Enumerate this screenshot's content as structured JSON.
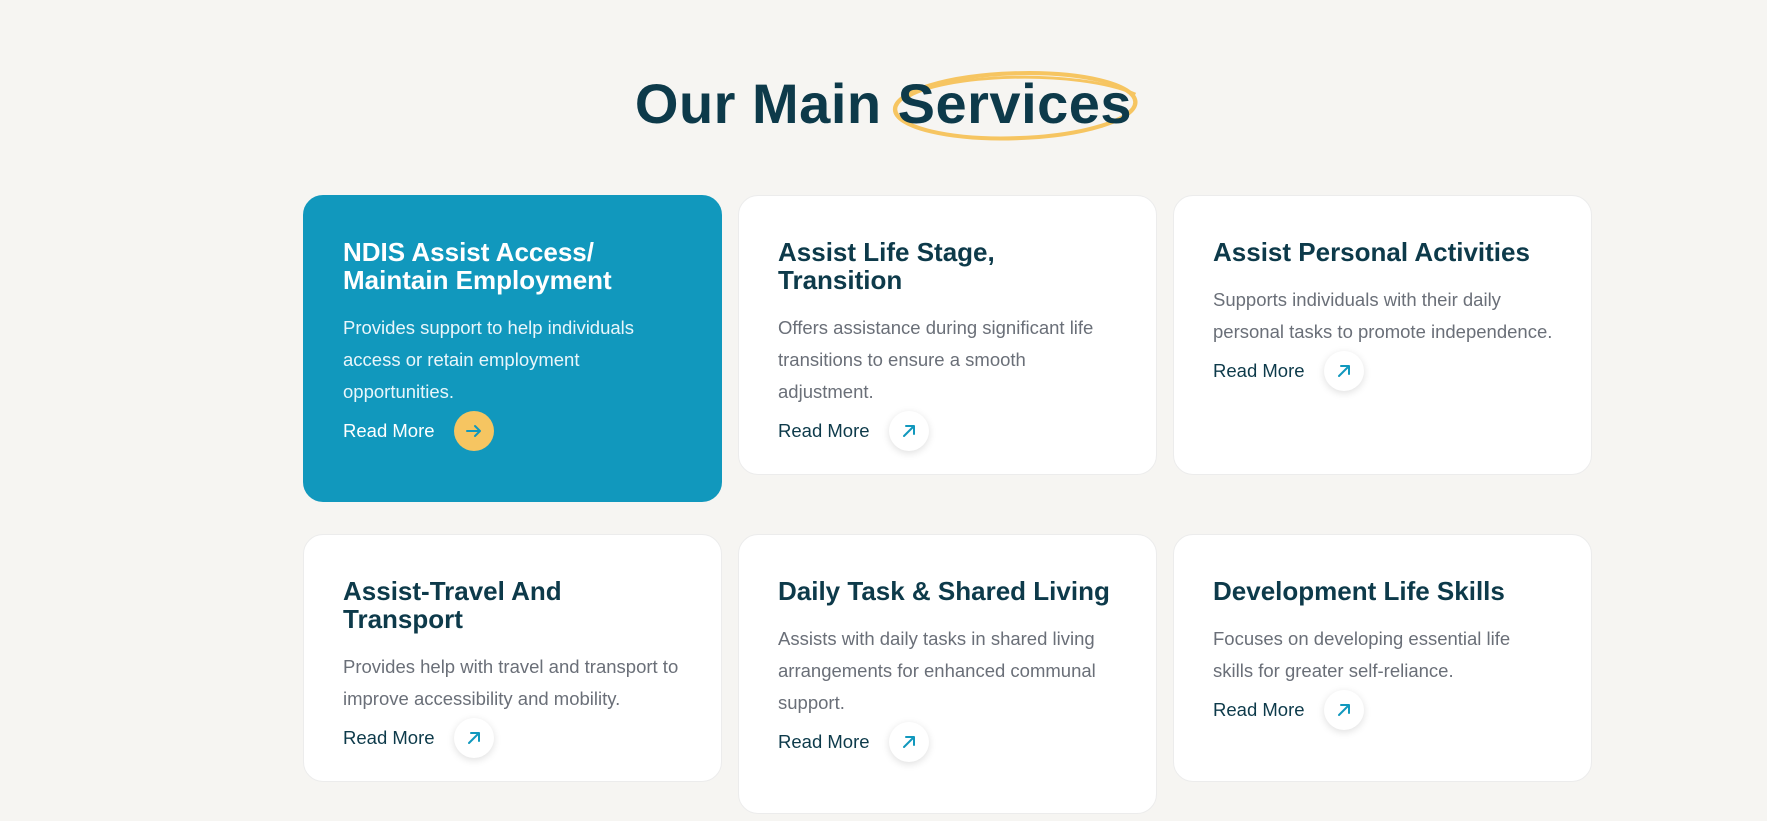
{
  "heading": {
    "prefix": "Our Main ",
    "highlight": "Services"
  },
  "services": [
    {
      "title": "NDIS Assist Access/ Maintain Employment",
      "description": "Provides support to help individuals access or retain employment opportunities.",
      "read_more": "Read More",
      "icon": "arrow-right-icon",
      "active": true
    },
    {
      "title": "Assist Life Stage, Transition",
      "description": "Offers assistance during significant life transitions to ensure a smooth adjustment.",
      "read_more": "Read More",
      "icon": "arrow-up-right-icon",
      "active": false
    },
    {
      "title": "Assist Personal Activities",
      "description": "Supports individuals with their daily personal tasks to promote independence.",
      "read_more": "Read More",
      "icon": "arrow-up-right-icon",
      "active": false
    },
    {
      "title": "Assist-Travel And Transport",
      "description": "Provides help with travel and transport to improve accessibility and mobility.",
      "read_more": "Read More",
      "icon": "arrow-up-right-icon",
      "active": false
    },
    {
      "title": "Daily Task & Shared Living",
      "description": "Assists with daily tasks in shared living arrangements for enhanced communal support.",
      "read_more": "Read More",
      "icon": "arrow-up-right-icon",
      "active": false
    },
    {
      "title": "Development Life Skills",
      "description": "Focuses on developing essential life skills for greater self-reliance.",
      "read_more": "Read More",
      "icon": "arrow-up-right-icon",
      "active": false
    }
  ],
  "colors": {
    "background": "#f6f5f2",
    "heading": "#0d3a4a",
    "accent": "#1198bd",
    "highlight": "#f6c561",
    "body_text": "#6a6f78"
  }
}
